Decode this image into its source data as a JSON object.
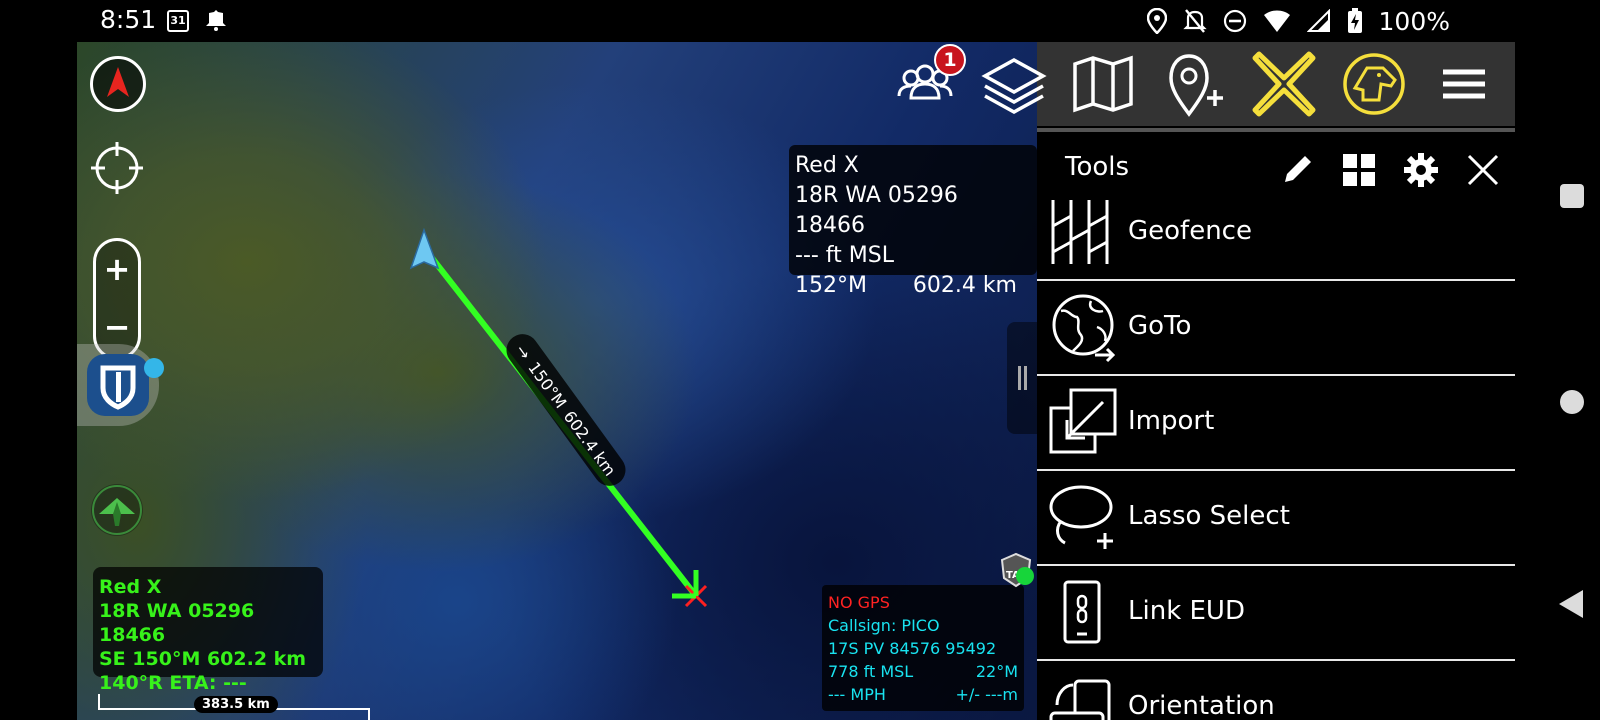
{
  "status_bar": {
    "time": "8:51",
    "calendar_day": "31",
    "battery": "100%",
    "icons": [
      "location-icon",
      "bell-off-icon",
      "dnd-icon",
      "wifi-icon",
      "signal-icon",
      "battery-charging-icon"
    ]
  },
  "map": {
    "controls": [
      "compass-icon",
      "locate-icon",
      "zoom-in-icon",
      "zoom-out-icon",
      "shield-icon",
      "tent-icon"
    ],
    "zoom_in": "+",
    "zoom_out": "−"
  },
  "toolbar": {
    "team_badge_count": "1",
    "icons": [
      "team-icon",
      "layers-icon",
      "map-icon",
      "add-point-icon",
      "close-x-icon",
      "dog-icon",
      "hamburger-menu-icon"
    ],
    "accent_color": "#f5df3c"
  },
  "red_x_info": {
    "name": "Red X",
    "coords": "18R WA 05296 18466",
    "altitude": "--- ft MSL",
    "bearing": "152°M",
    "distance": "602.4 km"
  },
  "route": {
    "bearing": "150°M",
    "distance": "602.4 km",
    "color": "#33ff22"
  },
  "target_info": {
    "line1": "Red X",
    "line2": "18R  WA  05296  18466",
    "line3": "SE   150°M 602.2 km",
    "line4": "140°R   ETA: ---",
    "color": "#37f21a"
  },
  "scale_bar": {
    "label": "383.5 km"
  },
  "self_info": {
    "gps_status": "NO GPS",
    "callsign": "Callsign: PICO",
    "coords": "17S  PV  84576  95492",
    "altitude": "778 ft MSL",
    "heading": "22°M",
    "speed": "--- MPH",
    "accuracy": "+/- ---m"
  },
  "tools_panel": {
    "title": "Tools",
    "header_icons": [
      "pencil-icon",
      "grid-icon",
      "gear-icon",
      "close-icon"
    ],
    "items": [
      {
        "label": "Geofence",
        "icon": "geofence-icon"
      },
      {
        "label": "GoTo",
        "icon": "globe-arrow-icon"
      },
      {
        "label": "Import",
        "icon": "import-icon"
      },
      {
        "label": "Lasso Select",
        "icon": "lasso-icon"
      },
      {
        "label": "Link EUD",
        "icon": "link-eud-icon"
      },
      {
        "label": "Orientation",
        "icon": "orientation-icon"
      }
    ]
  },
  "nav_bar": {
    "icons": [
      "recents-icon",
      "home-icon",
      "back-icon"
    ]
  }
}
